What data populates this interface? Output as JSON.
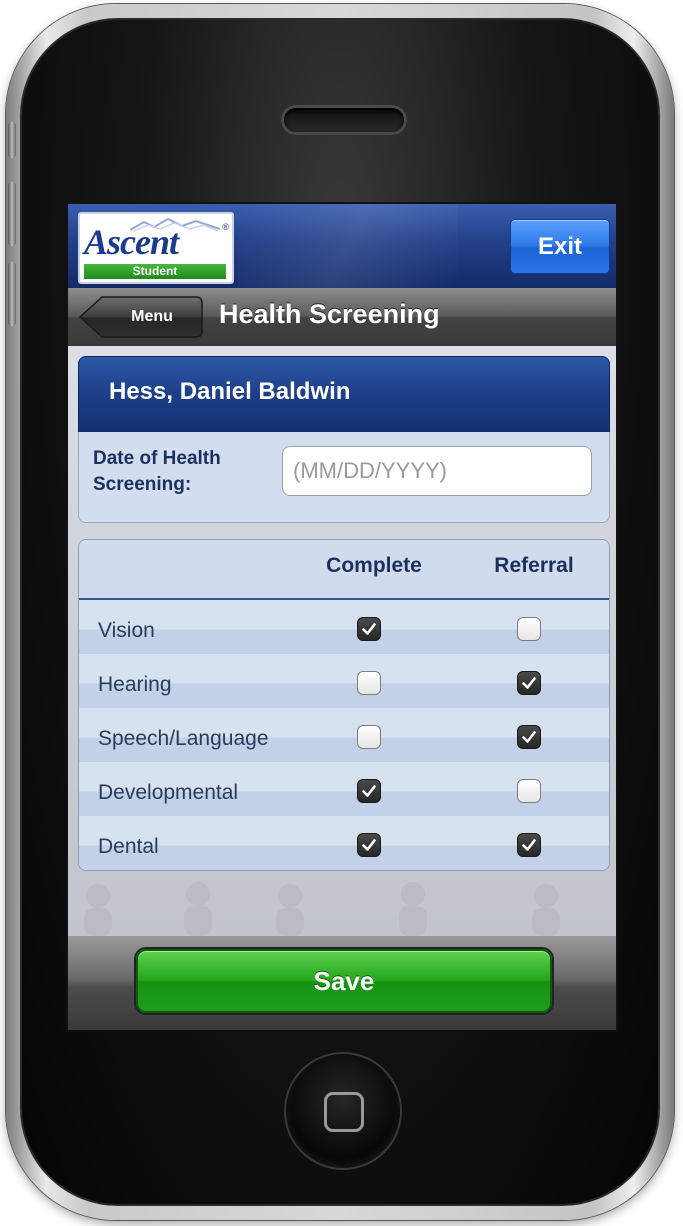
{
  "header": {
    "logo_text": "Ascent",
    "logo_registered": "®",
    "logo_subtitle": "Student",
    "exit_label": "Exit"
  },
  "navbar": {
    "back_label": "Menu",
    "title": "Health Screening"
  },
  "student": {
    "name": "Hess, Daniel Baldwin"
  },
  "date_field": {
    "label": "Date of Health Screening:",
    "placeholder": "(MM/DD/YYYY)",
    "value": ""
  },
  "screening_table": {
    "columns": [
      "Complete",
      "Referral"
    ],
    "rows": [
      {
        "label": "Vision",
        "complete": true,
        "referral": false
      },
      {
        "label": "Hearing",
        "complete": false,
        "referral": true
      },
      {
        "label": "Speech/Language",
        "complete": false,
        "referral": true
      },
      {
        "label": "Developmental",
        "complete": true,
        "referral": false
      },
      {
        "label": "Dental",
        "complete": true,
        "referral": true
      }
    ]
  },
  "footer": {
    "save_label": "Save"
  },
  "colors": {
    "header_blue": "#233f88",
    "exit_blue": "#2f7ae8",
    "save_green": "#26a81f",
    "row_light": "#d7e2f1",
    "text_navy": "#1d2f5f"
  },
  "icons": {
    "checkbox_checked": "checkmark-icon",
    "home_button": "home-square-icon"
  }
}
